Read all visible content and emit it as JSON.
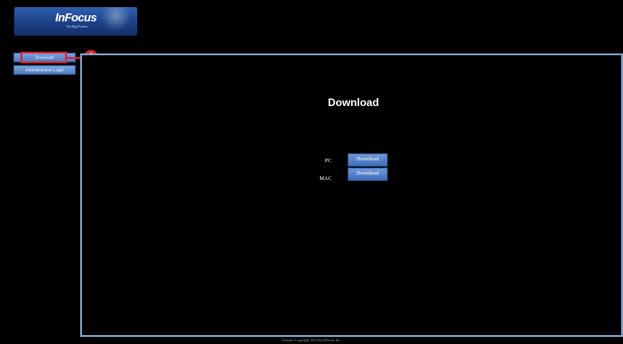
{
  "header": {
    "logo_text": "InFocus",
    "logo_tagline": "The Big Picture"
  },
  "sidebar": {
    "items": [
      {
        "label": "Download"
      },
      {
        "label": "Administration Login"
      }
    ]
  },
  "annotation": {
    "badge": "i",
    "color": "#e0202a"
  },
  "main": {
    "title": "Download",
    "rows": [
      {
        "label": "PC",
        "button": "Download"
      },
      {
        "label": "MAC",
        "button": "Download"
      }
    ]
  },
  "footer": {
    "text": "Contents Copyright 2013 by InFocus, Inc."
  },
  "colors": {
    "background": "#000000",
    "panel_border": "#7fa6cf",
    "button_blue": "#4f7cc4"
  }
}
